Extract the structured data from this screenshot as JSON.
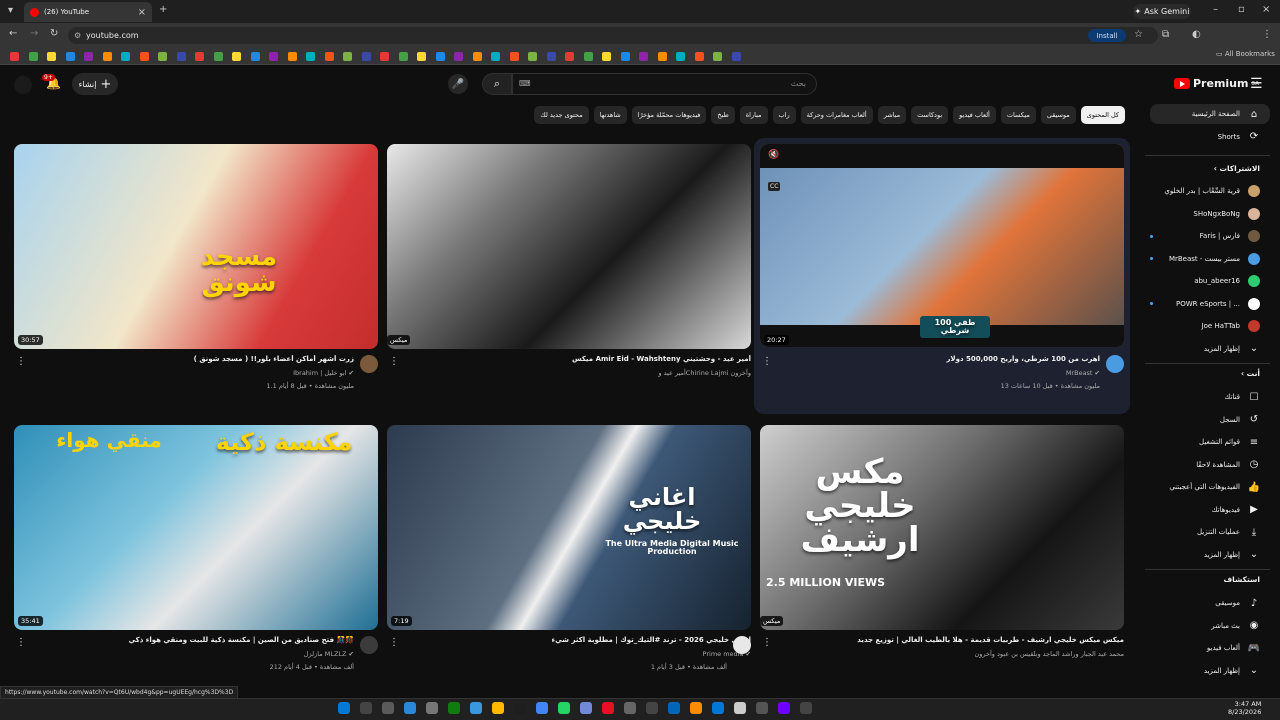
{
  "browser": {
    "tab_title": "(26) YouTube",
    "url": "youtube.com",
    "install_label": "Install",
    "gemini_label": "Ask Gemini",
    "all_bookmarks": "All Bookmarks",
    "status_url": "https://www.youtube.com/watch?v=Qt6U/wbd4g&pp=ugUEEg/hcg%3D%3D"
  },
  "header": {
    "logo_text": "Premium",
    "logo_region": "SA",
    "search_placeholder": "بحث",
    "create_label": "إنشاء",
    "notif_count": "9+"
  },
  "chips": [
    "كل المحتوى",
    "موسيقى",
    "ميكسات",
    "ألعاب فيديو",
    "بودكاست",
    "مباشر",
    "ألعاب مغامرات وحركة",
    "راب",
    "مباراة",
    "طبخ",
    "فيديوهات محمّلة مؤخرًا",
    "شاهدتها",
    "محتوى جديد لك"
  ],
  "sidebar": {
    "top": [
      {
        "label": "الصفحة الرئيسية",
        "icon": "home-icon",
        "glyph": "⌂"
      },
      {
        "label": "Shorts",
        "icon": "shorts-icon",
        "glyph": "⟳"
      }
    ],
    "subs_heading": "الاشتراكات",
    "subs": [
      {
        "label": "قرية السِّعْاب | بدر الخلوي",
        "color": "#c8a06a",
        "dot": false
      },
      {
        "label": "SHoNgxBoNg",
        "color": "#d9b49a",
        "dot": false
      },
      {
        "label": "Faris | فارس",
        "color": "#6f5a3e",
        "dot": true
      },
      {
        "label": "MrBeast - مستر بيست",
        "color": "#4a9be0",
        "dot": true
      },
      {
        "label": "abu_abeer16",
        "color": "#2ecc71",
        "dot": false
      },
      {
        "label": "POWR eSports | ...",
        "color": "#ffffff",
        "dot": true
      },
      {
        "label": "Joe HaTTab",
        "color": "#c0392b",
        "dot": false
      }
    ],
    "show_more": "إظهار المزيد",
    "you_heading": "أنت",
    "you": [
      {
        "label": "قناتك",
        "icon": "channel-icon",
        "glyph": "☐"
      },
      {
        "label": "السجل",
        "icon": "history-icon",
        "glyph": "↺"
      },
      {
        "label": "قوائم التشغيل",
        "icon": "playlists-icon",
        "glyph": "≡"
      },
      {
        "label": "المشاهدة لاحقًا",
        "icon": "watch-later-icon",
        "glyph": "◷"
      },
      {
        "label": "الفيديوهات التي أعجبتني",
        "icon": "like-icon",
        "glyph": "👍"
      },
      {
        "label": "فيديوهاتك",
        "icon": "your-videos-icon",
        "glyph": "▶"
      },
      {
        "label": "عمليات التنزيل",
        "icon": "download-icon",
        "glyph": "⤓"
      }
    ],
    "explore_heading": "استكشاف",
    "explore": [
      {
        "label": "موسيقى",
        "icon": "music-icon",
        "glyph": "♪"
      },
      {
        "label": "بث مباشر",
        "icon": "live-icon",
        "glyph": "◉"
      },
      {
        "label": "ألعاب فيديو",
        "icon": "gaming-icon",
        "glyph": "🎮"
      }
    ]
  },
  "videos": [
    {
      "title": "اهرب من 100 شرطي، واربح 500,000 دولار",
      "channel": "MrBeast",
      "stats": "13 مليون مشاهدة • قبل 10 ساعات",
      "duration": "20:27",
      "overlay": "طفي 100 شرطي",
      "verified": true
    },
    {
      "title": "ميكس Amir Eid - Wahshteny أمير عيد - وحشتيني",
      "channel": "أمير عيد و‎Chirine Lajmi وآخرون",
      "stats": "",
      "duration": "ميكس",
      "overlay": "",
      "verified": false
    },
    {
      "title": "( زرت أشهر أماكن أعضاء بلور!! ( مسجد شونق",
      "channel": "Ibrahim | ابو خليل",
      "stats": "1.1 مليون مشاهدة • قبل 8 أيام",
      "duration": "30:57",
      "overlay": "مسجد شونق",
      "verified": true
    },
    {
      "title": "ميكس ميكس خليجي ارشيف - طربيات قديمة - هلا بالطيب الغالي | توزيع جديد",
      "channel": "محمد عبد الجبار وراشد الماجد وبلقيس بن عبود وآخرون",
      "stats": "",
      "duration": "ميكس",
      "overlay": "مكس خليجي ارشيف",
      "overlay2": "2.5 MILLION VIEWS",
      "verified": false
    },
    {
      "title": "اغاني خليجي 2026 - ترند #التيك_توك | مطلوبة اكثر شيء",
      "channel": "Prime media",
      "stats": "1 ألف مشاهدة • قبل 3 أيام",
      "duration": "7:19",
      "overlay": "اغاني خليجي",
      "overlay2": "The Ultra Media Digital Music Production",
      "verified": true
    },
    {
      "title": "فتح صناديق من الصين | مكنسة ذكية للبيت ومنقي هواء ذكي 🎊🎊",
      "channel": "مازلزل MLZLZ",
      "stats": "212 ألف مشاهدة • قبل 4 أيام",
      "duration": "35:41",
      "overlay": "مكنسة ذكية",
      "overlay2": "منقي هواء",
      "verified": true
    }
  ],
  "taskbar": {
    "time": "3:47 AM",
    "date": "8/23/2026"
  },
  "colors": {
    "bg": "#0f0f0f",
    "chip": "#272727",
    "red": "#ff0000",
    "accent": "#3ea6ff"
  }
}
